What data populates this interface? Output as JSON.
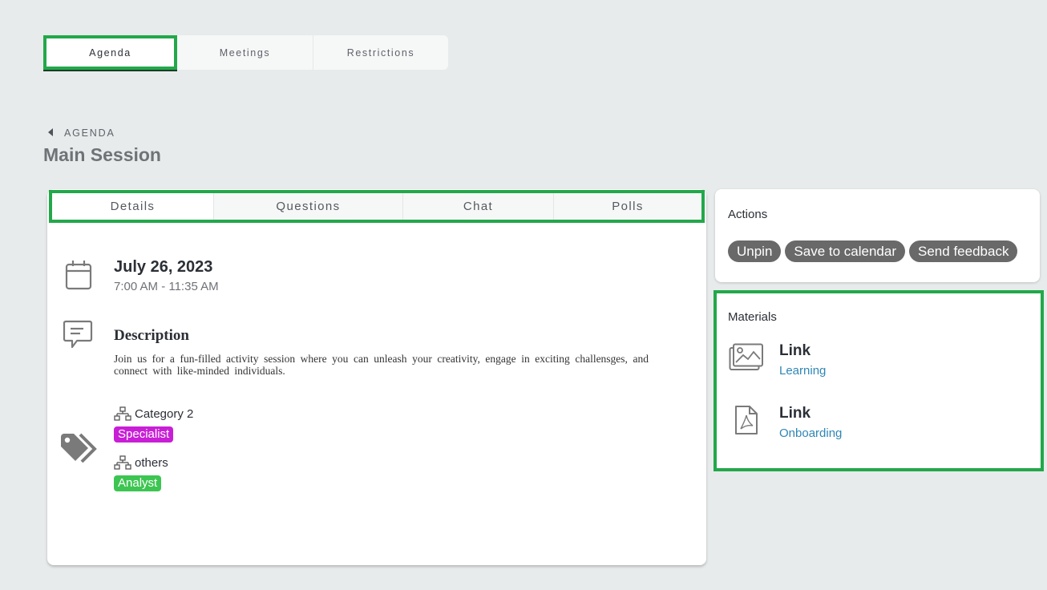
{
  "top_tabs": [
    {
      "label": "Agenda",
      "active": true
    },
    {
      "label": "Meetings",
      "active": false
    },
    {
      "label": "Restrictions",
      "active": false
    }
  ],
  "breadcrumb": {
    "label": "AGENDA",
    "icon": "caret-left-icon"
  },
  "page_title": "Main Session",
  "session_tabs": [
    {
      "label": "Details",
      "active": true
    },
    {
      "label": "Questions",
      "active": false
    },
    {
      "label": "Chat",
      "active": false
    },
    {
      "label": "Polls",
      "active": false
    }
  ],
  "details": {
    "date": "July 26, 2023",
    "time": "7:00 AM - 11:35 AM",
    "description_title": "Description",
    "description_text": "Join us for a fun-filled activity session where you can unleash your creativity, engage in exciting challensges, and connect with like-minded individuals.",
    "categories": [
      {
        "name": "Category 2",
        "tag": "Specialist",
        "tag_color": "#c81fd6"
      },
      {
        "name": "others",
        "tag": "Analyst",
        "tag_color": "#3dc552"
      }
    ]
  },
  "actions": {
    "heading": "Actions",
    "buttons": [
      "Unpin",
      "Save to calendar",
      "Send feedback"
    ]
  },
  "materials": {
    "heading": "Materials",
    "items": [
      {
        "title": "Link",
        "link": "Learning",
        "icon": "image-gallery-icon"
      },
      {
        "title": "Link",
        "link": "Onboarding",
        "icon": "pdf-file-icon"
      }
    ]
  },
  "colors": {
    "highlight": "#22a84a",
    "link": "#2f86b5",
    "pill": "#696969",
    "background": "#e8ebeb"
  }
}
